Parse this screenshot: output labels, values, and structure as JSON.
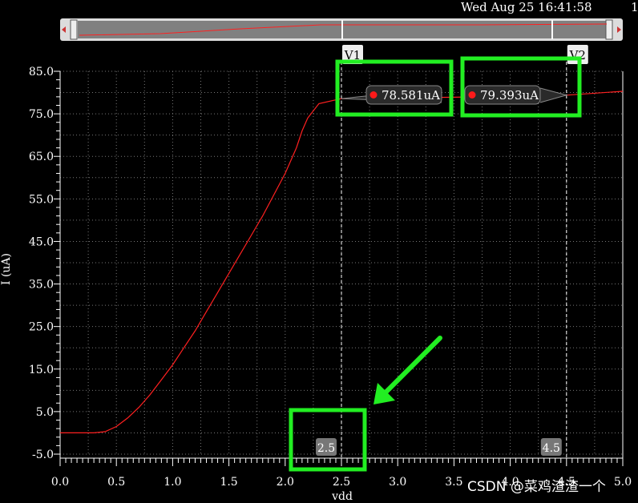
{
  "header": {
    "timestamp": "Wed Aug 25 16:41:58",
    "truncated": "1"
  },
  "watermark": "CSDN @菜鸡渣渣一个",
  "colors": {
    "trace": "#ff2020",
    "highlight": "#22ee22",
    "grid": "#777777"
  },
  "chart_data": {
    "type": "line",
    "title": "",
    "xlabel": "vdd",
    "ylabel": "I (uA)",
    "xlim": [
      0,
      5
    ],
    "ylim": [
      -5,
      85
    ],
    "x_ticks": [
      "0.0",
      "0.5",
      "1.0",
      "1.5",
      "2.0",
      "2.5",
      "3.0",
      "3.5",
      "4.0",
      "4.5",
      "5.0"
    ],
    "y_ticks": [
      "85.0",
      "75.0",
      "65.0",
      "55.0",
      "45.0",
      "35.0",
      "25.0",
      "15.0",
      "5.0",
      "-5.0"
    ],
    "grid": true,
    "series": [
      {
        "x": [
          0,
          0.3,
          0.4,
          0.5,
          0.6,
          0.7,
          0.8,
          0.9,
          1.0,
          1.1,
          1.2,
          1.3,
          1.4,
          1.5,
          1.6,
          1.7,
          1.8,
          1.9,
          2.0,
          2.1,
          2.15,
          2.2,
          2.3,
          2.5,
          3.0,
          3.5,
          4.0,
          4.5,
          5.0
        ],
        "y": [
          0,
          0,
          0.3,
          1.5,
          3.5,
          6,
          9,
          12.5,
          16,
          20,
          24,
          28.5,
          33,
          37.5,
          42,
          46.5,
          51,
          56,
          61,
          67,
          71,
          74,
          77.4,
          78.58,
          78.75,
          78.9,
          79.1,
          79.39,
          80.3
        ]
      }
    ],
    "markers": [
      {
        "name": "V1",
        "x": 2.5,
        "y": 78.581,
        "label": "78.581uA",
        "x_label": "2.5"
      },
      {
        "name": "V2",
        "x": 4.5,
        "y": 79.393,
        "label": "79.393uA",
        "x_label": "4.5"
      }
    ]
  }
}
